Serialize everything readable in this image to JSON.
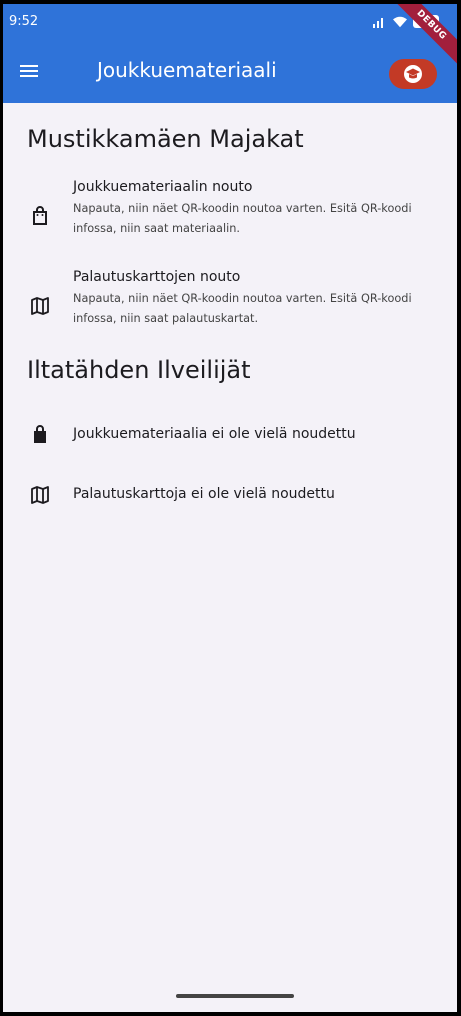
{
  "status": {
    "time": "9:52"
  },
  "appbar": {
    "title": "Joukkuemateriaali",
    "debug_label": "DEBUG"
  },
  "sections": [
    {
      "title": "Mustikkamäen Majakat",
      "items": [
        {
          "icon": "shopping-bag-outline-icon",
          "title": "Joukkuemateriaalin nouto",
          "subtitle": "Napauta, niin näet QR-koodin noutoa varten. Esitä QR-koodi infossa, niin saat materiaalin."
        },
        {
          "icon": "map-outline-icon",
          "title": "Palautuskarttojen nouto",
          "subtitle": "Napauta, niin näet QR-koodin noutoa varten. Esitä QR-koodi infossa, niin saat palautuskartat."
        }
      ]
    },
    {
      "title": "Iltatähden Ilveilijät",
      "items": [
        {
          "icon": "shopping-bag-filled-icon",
          "title": "Joukkuemateriaalia ei ole vielä noudettu"
        },
        {
          "icon": "map-outline-icon",
          "title": "Palautuskarttoja ei ole vielä noudettu"
        }
      ]
    }
  ],
  "colors": {
    "appbar": "#2f73d9",
    "team_button": "#c33a26",
    "background": "#f4f2f8"
  }
}
